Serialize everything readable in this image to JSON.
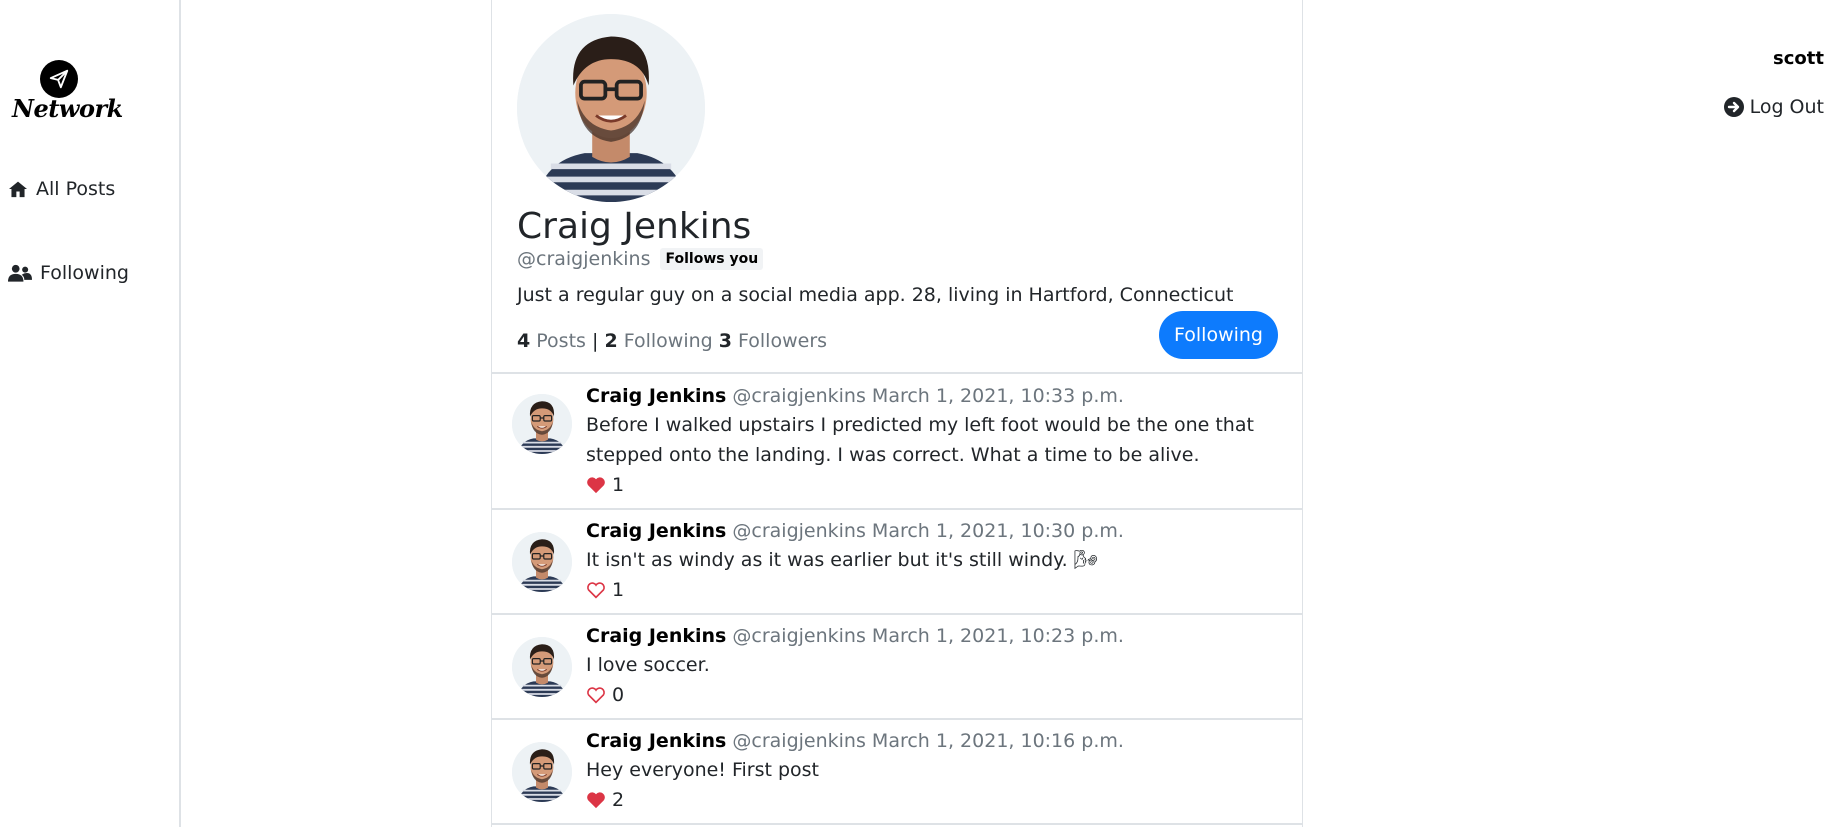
{
  "app": {
    "logo_text": "Network",
    "nav": [
      {
        "label": "All Posts",
        "icon": "home-icon"
      },
      {
        "label": "Following",
        "icon": "users-icon"
      }
    ]
  },
  "user": {
    "username": "scott",
    "logout_label": "Log Out"
  },
  "profile": {
    "name": "Craig Jenkins",
    "handle": "@craigjenkins",
    "follows_you_badge": "Follows you",
    "bio": "Just a regular guy on a social media app. 28, living in Hartford, Connecticut",
    "posts_count": "4",
    "posts_label": "Posts",
    "separator": "|",
    "following_count": "2",
    "following_label": "Following",
    "followers_count": "3",
    "followers_label": "Followers",
    "follow_button_label": "Following",
    "button_color": "#0d7bfd"
  },
  "posts": [
    {
      "author": "Craig Jenkins",
      "handle": "@craigjenkins",
      "time": "March 1, 2021, 10:33 p.m.",
      "text": "Before I walked upstairs I predicted my left foot would be the one that stepped onto the landing. I was correct. What a time to be alive.",
      "likes": "1",
      "liked": true
    },
    {
      "author": "Craig Jenkins",
      "handle": "@craigjenkins",
      "time": "March 1, 2021, 10:30 p.m.",
      "text": "It isn't as windy as it was earlier but it's still windy. 🌬",
      "likes": "1",
      "liked": false
    },
    {
      "author": "Craig Jenkins",
      "handle": "@craigjenkins",
      "time": "March 1, 2021, 10:23 p.m.",
      "text": "I love soccer.",
      "likes": "0",
      "liked": false
    },
    {
      "author": "Craig Jenkins",
      "handle": "@craigjenkins",
      "time": "March 1, 2021, 10:16 p.m.",
      "text": "Hey everyone! First post",
      "likes": "2",
      "liked": true
    }
  ],
  "colors": {
    "heart": "#dc3545",
    "muted": "#6c757d"
  }
}
